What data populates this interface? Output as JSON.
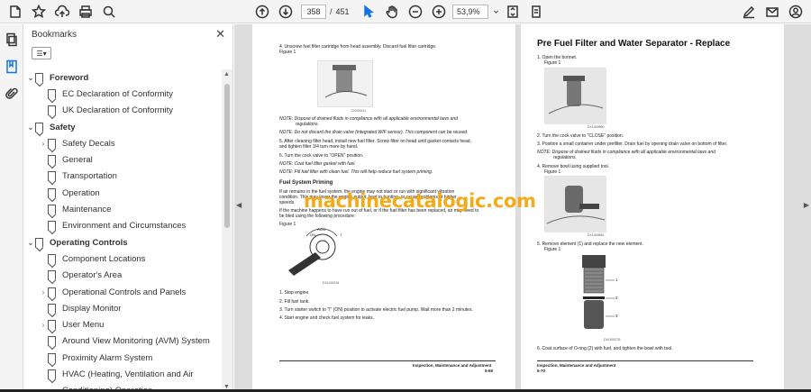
{
  "toolbar": {
    "current_page": "358",
    "page_separator": "/",
    "total_pages": "451",
    "zoom": "53,9%",
    "icons": [
      "home-icon",
      "star-icon",
      "upload-icon",
      "print-icon",
      "zoom-search-icon",
      "page-up-icon",
      "page-down-icon",
      "select-cursor-icon",
      "hand-icon",
      "zoom-out-icon",
      "zoom-in-icon",
      "fit-page-icon",
      "comment-icon",
      "pen-sign-icon",
      "mail-icon",
      "account-icon"
    ]
  },
  "bookmarks": {
    "title": "Bookmarks",
    "close_label": "✕",
    "options_label": "☰▾",
    "items": [
      {
        "label": "Foreword",
        "level": 0,
        "chevron": "⌄"
      },
      {
        "label": "EC Declaration of Conformity",
        "level": 1,
        "chevron": ""
      },
      {
        "label": "UK Declaration of Conformity",
        "level": 1,
        "chevron": ""
      },
      {
        "label": "Safety",
        "level": 0,
        "chevron": "⌄"
      },
      {
        "label": "Safety Decals",
        "level": 1,
        "chevron": "›"
      },
      {
        "label": "General",
        "level": 1,
        "chevron": ""
      },
      {
        "label": "Transportation",
        "level": 1,
        "chevron": ""
      },
      {
        "label": "Operation",
        "level": 1,
        "chevron": ""
      },
      {
        "label": "Maintenance",
        "level": 1,
        "chevron": ""
      },
      {
        "label": "Environment and Circumstances",
        "level": 1,
        "chevron": ""
      },
      {
        "label": "Operating Controls",
        "level": 0,
        "chevron": "⌄"
      },
      {
        "label": "Component Locations",
        "level": 1,
        "chevron": ""
      },
      {
        "label": "Operator's Area",
        "level": 1,
        "chevron": ""
      },
      {
        "label": "Operational Controls and Panels",
        "level": 1,
        "chevron": "›"
      },
      {
        "label": "Display Monitor",
        "level": 1,
        "chevron": ""
      },
      {
        "label": "User Menu",
        "level": 1,
        "chevron": "›"
      },
      {
        "label": "Around View Monitoring (AVM) System",
        "level": 1,
        "chevron": ""
      },
      {
        "label": "Proximity Alarm System",
        "level": 1,
        "chevron": ""
      },
      {
        "label": "HVAC (Heating, Ventilation and Air",
        "level": 1,
        "chevron": ""
      },
      {
        "label": "Conditioning) Operation",
        "level": 1,
        "chevron": ""
      }
    ]
  },
  "page_left": {
    "step4": "4.   Unscrew fuel filter cartridge from head assembly. Discard fuel filter cartridge.",
    "figure1a": "Figure 1",
    "cap1": "DX000111",
    "note1": "NOTE:   Dispose of drained fluids in compliance with all applicable environmental laws and",
    "note1b": "regulations.",
    "note2": "NOTE:   Do not discard the drain valve (integrated WIF sensor). This component can be reused.",
    "step5": "5.   After cleaning filter head, install new fuel filter. Screw filter on head until gasket contacts head,",
    "step5b": "      and tighten filter 3/4 turn more by hand.",
    "step6": "6.   Turn the cock valve to \"OPEN\" position.",
    "note3": "NOTE:   Coat fuel filter gasket with fuel.",
    "note4": "NOTE:   Fill fuel filter with clean fuel. This will help reduce fuel system priming.",
    "priming_title": "Fuel System Priming",
    "priming1": "If air remains in the fuel system, the engine may not start or run with significant vibration",
    "priming2": "condition. This may lower the engine output, lead to hunting, or cause problems at higher",
    "priming3": "speeds.",
    "priming4": "If the machine happens to have run out of fuel, or if the fuel filter has been replaced, air may need to",
    "priming5": "be bled using the following procedure:",
    "figure1b": "Figure 1",
    "key_acc": "ACC",
    "key_on": "ON",
    "key_i": "I",
    "cap2": "DX1400154",
    "s1": "1.   Stop engine.",
    "s2": "2.   Fill fuel tank.",
    "s3": "3.   Turn starter switch to \"I\" (ON) position to activate electric fuel pump. Wait more than 2 minutes.",
    "s4": "4.   Start engine and check fuel system for leaks.",
    "footer_title": "Inspection, Maintenance and Adjustment",
    "footer_page": "5-69"
  },
  "page_right": {
    "title": "Pre Fuel Filter and Water Separator - Replace",
    "r1": "1.   Open the bonnet.",
    "fig1": "Figure 1",
    "cap1": "DX1400860",
    "r2": "2.   Turn the cock valve to \"CLOSE\" position.",
    "r3": "3.   Position a small container under prefilter. Drain fuel by opening drain valve on bottom of filter.",
    "rnote": "NOTE:   Dispose of drained fluids in compliance with all applicable environmental laws and",
    "rnote_b": "regulations.",
    "r4": "4.   Remove bowl using supplied tool.",
    "fig2": "Figure 1",
    "cap2": "DX1400861",
    "r5": "5.   Remove element (1) and replace the new element.",
    "fig3": "Figure 1",
    "callout1": "1",
    "callout2": "2",
    "callout3": "3",
    "cap3": "DX1900733",
    "r6": "6.   Coat surface of O-ring (2) with fuel, and tighten the bowl with tool.",
    "footer_title": "Inspection, Maintenance and Adjustment",
    "footer_page": "5-70"
  },
  "watermark": "machinecatalogic.com"
}
